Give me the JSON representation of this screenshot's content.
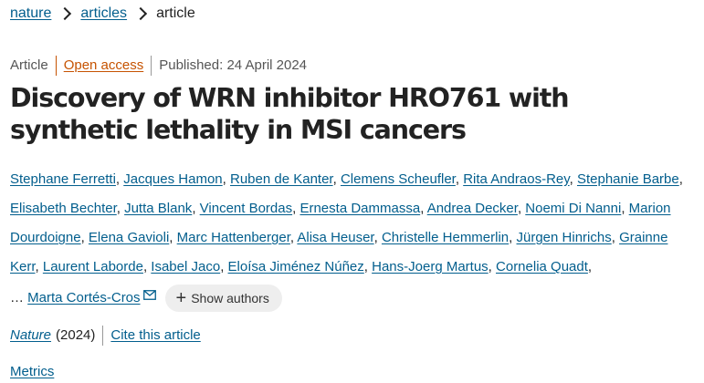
{
  "breadcrumb": {
    "items": [
      "nature",
      "articles"
    ],
    "current": "article"
  },
  "meta": {
    "type": "Article",
    "access": "Open access",
    "published": "Published: 24 April 2024"
  },
  "title": "Discovery of WRN inhibitor HRO761 with synthetic lethality in MSI cancers",
  "authors": [
    "Stephane Ferretti",
    "Jacques Hamon",
    "Ruben de Kanter",
    "Clemens Scheufler",
    "Rita Andraos-Rey",
    "Stephanie Barbe",
    "Elisabeth Bechter",
    "Jutta Blank",
    "Vincent Bordas",
    "Ernesta Dammassa",
    "Andrea Decker",
    "Noemi Di Nanni",
    "Marion Dourdoigne",
    "Elena Gavioli",
    "Marc Hattenberger",
    "Alisa Heuser",
    "Christelle Hemmerlin",
    "Jürgen Hinrichs",
    "Grainne Kerr",
    "Laurent Laborde",
    "Isabel Jaco",
    "Eloísa Jiménez Núñez",
    "Hans-Joerg Martus",
    "Cornelia Quadt"
  ],
  "ellipsis": "…",
  "last_author": "Marta Cortés-Cros",
  "show_authors_label": "Show authors",
  "journal": {
    "name": "Nature",
    "year": "(2024)",
    "cite_label": "Cite this article"
  },
  "metrics_label": "Metrics"
}
